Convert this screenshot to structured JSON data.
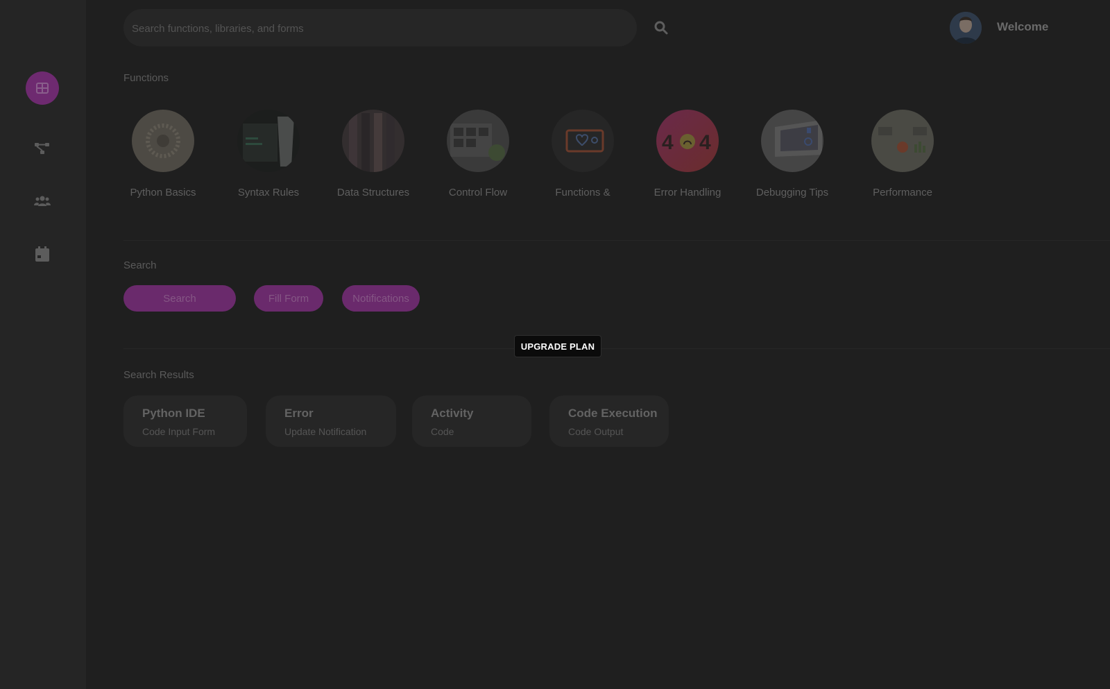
{
  "search": {
    "placeholder": "Search functions, libraries, and forms"
  },
  "header": {
    "welcome": "Welcome"
  },
  "sidebar": {
    "items": [
      {
        "icon": "dashboard-icon",
        "active": true
      },
      {
        "icon": "workflow-icon",
        "active": false
      },
      {
        "icon": "users-icon",
        "active": false
      },
      {
        "icon": "calendar-icon",
        "active": false
      }
    ]
  },
  "functions": {
    "title": "Functions",
    "items": [
      {
        "label": "Python Basics"
      },
      {
        "label": "Syntax Rules"
      },
      {
        "label": "Data Structures"
      },
      {
        "label": "Control Flow"
      },
      {
        "label": "Functions &"
      },
      {
        "label": "Error Handling"
      },
      {
        "label": "Debugging Tips"
      },
      {
        "label": "Performance"
      }
    ]
  },
  "search_section": {
    "title": "Search",
    "chips": [
      "Search",
      "Fill Form",
      "Notifications"
    ]
  },
  "upgrade": {
    "label": "UPGRADE PLAN"
  },
  "results": {
    "title": "Search Results",
    "cards": [
      {
        "title": "Python IDE",
        "subtitle": "Code Input Form"
      },
      {
        "title": "Error",
        "subtitle": "Update Notification"
      },
      {
        "title": "Activity",
        "subtitle": "Code"
      },
      {
        "title": "Code Execution",
        "subtitle": "Code Output"
      }
    ]
  },
  "colors": {
    "accent": "#6e2a70",
    "background": "#1f1f1f",
    "sidebar": "#252525"
  }
}
